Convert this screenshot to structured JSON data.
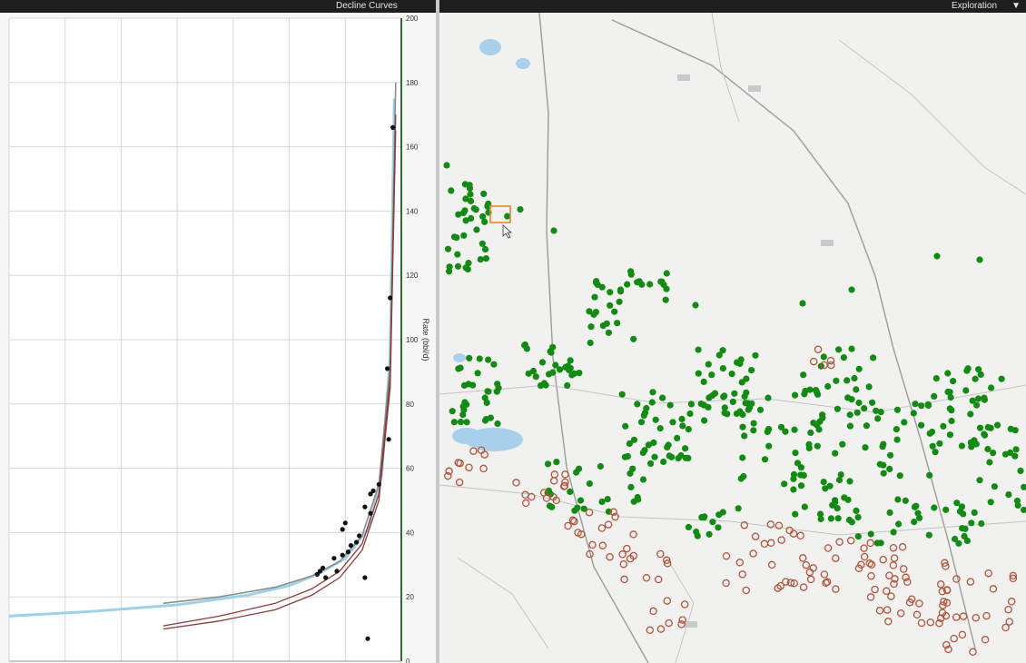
{
  "panes": {
    "left": {
      "title": "Decline Curves"
    },
    "right": {
      "title": "Exploration",
      "title_icon": "filter-icon"
    }
  },
  "colors": {
    "frame_dark": "#1e1e1e",
    "chart_frame": "#2f6b2f",
    "fit_blue": "#9fd2e6",
    "fit_grey": "#8d8d8d",
    "fit_red": "#8a3b3b",
    "well_active": "#138a13",
    "well_inactive": "#b2553e",
    "selection": "#e08a2c",
    "water": "#a9d0ea",
    "road": "#8c8c8c"
  },
  "chart_data": {
    "type": "scatter",
    "title": "Decline Curves",
    "ylabel": "Rate (bbl/d)",
    "xlabel": "",
    "y_ticks": [
      "200",
      "180",
      "160",
      "140",
      "120",
      "100",
      "80",
      "60",
      "40",
      "20",
      "0"
    ],
    "ylim": [
      0,
      200
    ],
    "xlim": [
      0,
      14
    ],
    "grid": true,
    "points": [
      {
        "x": 13.7,
        "y": 166
      },
      {
        "x": 13.6,
        "y": 113
      },
      {
        "x": 13.5,
        "y": 91
      },
      {
        "x": 13.55,
        "y": 69
      },
      {
        "x": 13.2,
        "y": 55
      },
      {
        "x": 13.0,
        "y": 53
      },
      {
        "x": 12.9,
        "y": 52
      },
      {
        "x": 12.7,
        "y": 48
      },
      {
        "x": 12.9,
        "y": 46
      },
      {
        "x": 12.0,
        "y": 43
      },
      {
        "x": 11.9,
        "y": 41
      },
      {
        "x": 12.5,
        "y": 39
      },
      {
        "x": 12.4,
        "y": 37
      },
      {
        "x": 12.2,
        "y": 36
      },
      {
        "x": 12.1,
        "y": 34
      },
      {
        "x": 11.9,
        "y": 33
      },
      {
        "x": 11.6,
        "y": 32
      },
      {
        "x": 11.2,
        "y": 29
      },
      {
        "x": 11.1,
        "y": 28
      },
      {
        "x": 11.0,
        "y": 27
      },
      {
        "x": 11.3,
        "y": 26
      },
      {
        "x": 11.7,
        "y": 28
      },
      {
        "x": 12.7,
        "y": 26
      },
      {
        "x": 12.8,
        "y": 7
      }
    ],
    "series": [
      {
        "x": [
          0.0,
          3.0,
          6.0,
          8.5,
          10.0,
          11.0,
          12.0,
          12.8,
          13.3,
          13.6,
          13.75
        ],
        "values": [
          14,
          15.5,
          17.5,
          20.5,
          23.5,
          27,
          32,
          41,
          58,
          95,
          175
        ]
      },
      {
        "x": [
          5.5,
          7.5,
          9.5,
          10.8,
          11.8,
          12.6,
          13.2,
          13.6,
          13.8
        ],
        "values": [
          18,
          20,
          23,
          26.5,
          31,
          39,
          55,
          92,
          180
        ]
      },
      {
        "x": [
          5.5,
          7.5,
          9.5,
          10.8,
          11.8,
          12.6,
          13.2,
          13.6,
          13.8
        ],
        "values": [
          11,
          14,
          18,
          22.5,
          28,
          36.5,
          52,
          88,
          170
        ]
      },
      {
        "x": [
          5.5,
          7.5,
          9.5,
          10.8,
          11.8,
          12.6,
          13.2,
          13.6,
          13.8
        ],
        "values": [
          10,
          12.5,
          16,
          20.5,
          26,
          34.5,
          50,
          85,
          165
        ]
      }
    ]
  },
  "map": {
    "selected_well": "selected-well"
  }
}
